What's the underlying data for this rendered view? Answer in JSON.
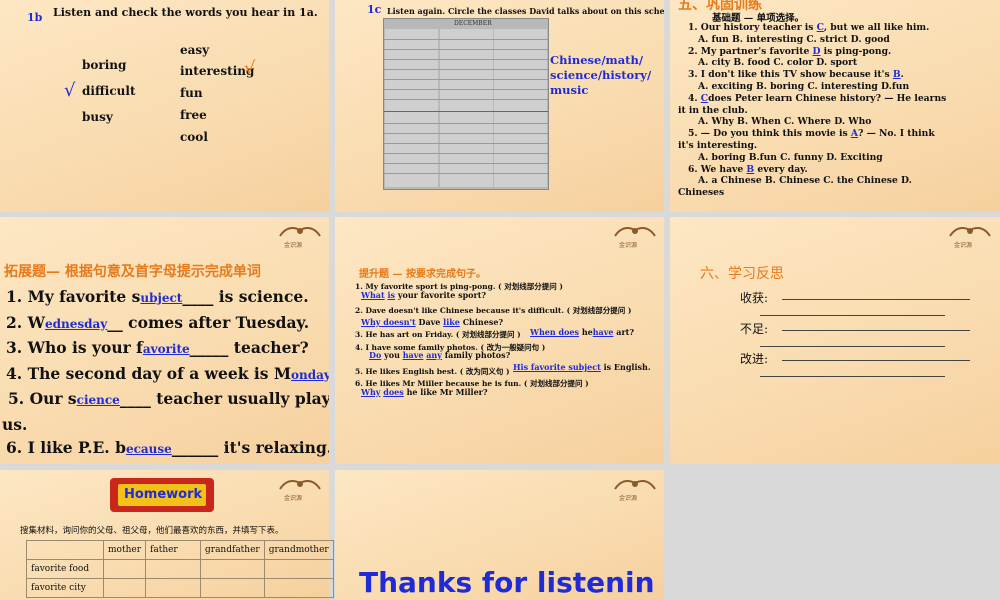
{
  "slide1": {
    "tag": "1b",
    "instruction": "Listen and check the words you hear in 1a.",
    "left_words": [
      "boring",
      "difficult",
      "busy"
    ],
    "right_words": [
      "easy",
      "interesting",
      "fun",
      "free",
      "cool"
    ],
    "check": "√"
  },
  "slide2": {
    "tag": "1c",
    "instruction": "Listen again. Circle the classes David talks about on this schedule.",
    "answer_lines": [
      "Chinese/math/",
      "science/history/",
      "music"
    ],
    "calendar_title": "DECEMBER"
  },
  "slide3": {
    "heading": "五、巩固训练",
    "subheading": "基础题 — 单项选择。",
    "items": [
      {
        "q": "1. Our history teacher is",
        "ans": "C",
        "rest": ", but we all like him."
      },
      {
        "q": "A. fun    B. interesting   C. strict    D. good"
      },
      {
        "q": "2. My partner's favorite",
        "ans": "D",
        "rest": " is ping-pong."
      },
      {
        "q": "A. city    B. food    C. color    D. sport"
      },
      {
        "q": "3. I don't like this TV show because it's",
        "ans": "B",
        "rest": "."
      },
      {
        "q": "A. exciting    B. boring    C. interesting    D.fun"
      },
      {
        "q": "4.",
        "ans": "C",
        "rest": "does Peter learn Chinese history? — He learns"
      },
      {
        "q": "it in the club."
      },
      {
        "q": "A. Why    B. When    C. Where    D. Who"
      },
      {
        "q": "5. — Do you think this movie is",
        "ans": "A",
        "rest": "?  — No. I think"
      },
      {
        "q": "it's interesting."
      },
      {
        "q": "A. boring    B.fun    C. funny    D. Exciting"
      },
      {
        "q": "6. We have",
        "ans": "B",
        "rest": " every day."
      },
      {
        "q": "A. a Chinese       B. Chinese      C. the Chinese      D."
      },
      {
        "q": "Chineses"
      }
    ]
  },
  "slide4": {
    "heading": "拓展题— 根据句意及首字母提示完成单词",
    "items": [
      {
        "pre": "1. My favorite s",
        "ans": "ubject",
        "post": " is science."
      },
      {
        "pre": "2. W",
        "ans": "ednesday",
        "post": " comes after Tuesday."
      },
      {
        "pre": "3. Who is your f",
        "ans": "avorite",
        "post": " teacher?"
      },
      {
        "pre": "4. The second day of a week is M",
        "ans": "onday",
        "post": "."
      },
      {
        "pre": "5. Our s",
        "ans": "cience",
        "post": " teacher usually plays with"
      },
      {
        "pre": "us.",
        "ans": "",
        "post": ""
      },
      {
        "pre": "6. I like P.E. b",
        "ans": "ecause",
        "post": " it's relaxing."
      }
    ]
  },
  "slide5": {
    "heading": "提升题 — 按要求完成句子。",
    "lines": [
      "1. My favorite sport is ping-pong. ( 对划线部分提问 )",
      "2. Dave doesn't like Chinese because it's difficult. ( 对划线部分提问 )",
      "3. He has art on Friday. ( 对划线部分提问 )",
      "4. I have some family photos. ( 改为一般疑问句 )",
      "5. He likes English best. ( 改为同义句 )",
      "6. He likes Mr Miller because he is fun. ( 对划线部分提问 )"
    ],
    "a1": [
      "What",
      "is",
      "your favorite sport?"
    ],
    "a2": [
      "Why doesn't",
      "Dave",
      "like",
      "Chinese?"
    ],
    "a3": [
      "When does",
      "he",
      "have",
      "art?"
    ],
    "a4": [
      "Do",
      "you",
      "have",
      "any",
      "family photos?"
    ],
    "a5": [
      "His favorite subject",
      "is English."
    ],
    "a6": [
      "Why",
      "does",
      "he like Mr Miller?"
    ]
  },
  "slide6": {
    "heading": "六、学习反思",
    "labels": [
      "收获:",
      "不足:",
      "改进:"
    ]
  },
  "slide7": {
    "badge": "Homework",
    "instruction": "搜集材料，询问你的父母、祖父母，他们最喜欢的东西，并填写下表。",
    "columns": [
      "",
      "mother",
      "father",
      "grandfather",
      "grandmother"
    ],
    "rows": [
      "favorite food",
      "favorite city",
      ""
    ]
  },
  "slide8": {
    "thanks": "Thanks for listenin"
  },
  "logo_caption": "金识源",
  "colors": {
    "blue": "#1f2bd6",
    "orange": "#e87a1a",
    "bg": "#fde7c4"
  }
}
